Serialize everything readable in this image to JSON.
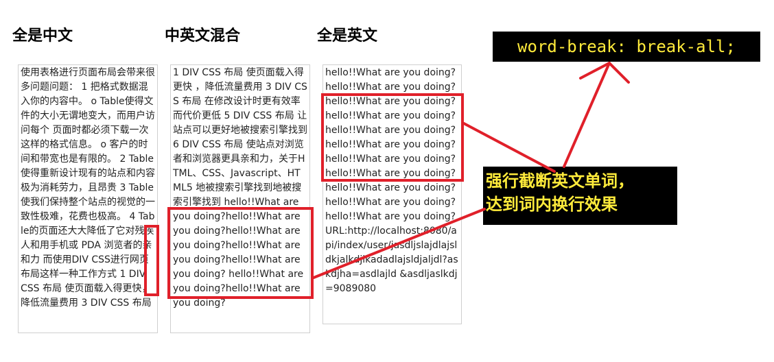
{
  "columns": [
    {
      "title": "全是中文",
      "text": "使用表格进行页面布局会带来很多问题问题： 1 把格式数据混入你的内容中。 o Table使得文件的大小无谓地变大，而用户访问每个 页面时都必须下载一次这样的格式信息。 o 客户的时间和带宽也是有限的。 2 Table使得重新设计现有的站点和内容极为消耗劳力，且昂贵 3 Table使我们保持整个站点的视觉的一致性极难，花费也极高。 4 Table的页面还大大降低了它对残疾人和用手机或 PDA 浏览者的亲和力 而使用DIV CSS进行网页布局这样一种工作方式 1 DIV CSS 布局 使页面载入得更快， 降低流量费用 3 DIV CSS 布局"
    },
    {
      "title": "中英文混合",
      "text": "1 DIV CSS 布局 使页面载入得更快 ，降低流量费用 3 DIV CSS 布局 在修改设计时更有效率而代价更低 5 DIV CSS 布局 让站点可以更好地被搜索引擎找到 6 DIV CSS 布局 使站点对浏览者和浏览器更具亲和力，关于HTML、CSS、Javascript、HTML5 地被搜索引擎找到地被搜索引擎找到 hello!!What are you doing?hello!!What are you doing?hello!!What are you doing?hello!!What are you doing?hello!!What are you doing? hello!!What are you doing?hello!!What are you doing?"
    },
    {
      "title": "全是英文",
      "text": "hello!!What are you doing?hello!!What are you doing?hello!!What are you doing?hello!!What are you doing?hello!!What are you doing?hello!!What are you doing? hello!!What are you doing?hello!!What are you doing?hello!!What are you doing?hello!!What are you doing?hello!!What are you doing? URL:http://localhost:8080/api/index/user/jasdljslajdlajsldkjalkdjlkadadlajsldjaljdl?askdjha=asdlajld &asdljaslkdj=9089080"
    }
  ],
  "annotations": {
    "code": "word-break: break-all;",
    "note_line1": "强行截断英文单词，",
    "note_line2": "达到词内换行效果",
    "accent_color": "#e0202a",
    "label_bg": "#000000",
    "label_fg": "#ffeb3b"
  }
}
